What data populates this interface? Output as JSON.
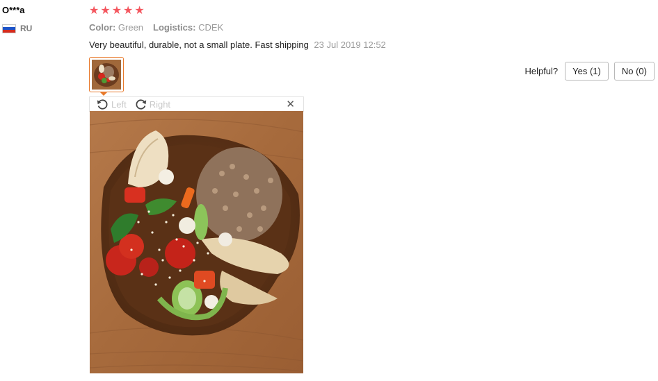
{
  "user": {
    "name": "O***a",
    "country_code": "RU",
    "flag_colors": [
      "#ffffff",
      "#1c53c9",
      "#d52b1e"
    ]
  },
  "review": {
    "rating": 5,
    "star_glyph": "★",
    "star_color": "#f4565e",
    "attributes": [
      {
        "label": "Color:",
        "value": "Green"
      },
      {
        "label": "Logistics:",
        "value": "CDEK"
      }
    ],
    "text": "Very beautiful, durable, not a small plate. Fast shipping",
    "date": "23 Jul 2019 12:52"
  },
  "helpful": {
    "label": "Helpful?",
    "yes_label": "Yes (1)",
    "no_label": "No (0)"
  },
  "viewer": {
    "rotate_left_label": "Left",
    "rotate_right_label": "Right",
    "close_glyph": "✕",
    "accent_color": "#e87a2c"
  }
}
